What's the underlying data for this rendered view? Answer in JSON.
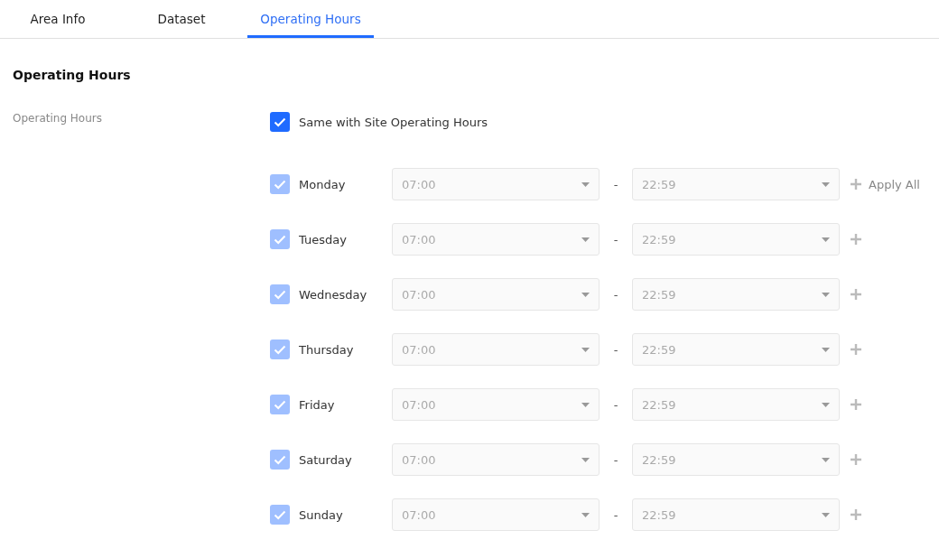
{
  "tabs": [
    {
      "label": "Area Info",
      "selected": false
    },
    {
      "label": "Dataset",
      "selected": false
    },
    {
      "label": "Operating Hours",
      "selected": true
    }
  ],
  "section_title": "Operating Hours",
  "field_label": "Operating Hours",
  "same_as_site": {
    "label": "Same with Site Operating Hours",
    "checked": true
  },
  "days": [
    {
      "name": "Monday",
      "checked": true,
      "disabled": true,
      "start": "07:00",
      "end": "22:59",
      "separator": "-",
      "apply_all": "Apply All"
    },
    {
      "name": "Tuesday",
      "checked": true,
      "disabled": true,
      "start": "07:00",
      "end": "22:59",
      "separator": "-"
    },
    {
      "name": "Wednesday",
      "checked": true,
      "disabled": true,
      "start": "07:00",
      "end": "22:59",
      "separator": "-"
    },
    {
      "name": "Thursday",
      "checked": true,
      "disabled": true,
      "start": "07:00",
      "end": "22:59",
      "separator": "-"
    },
    {
      "name": "Friday",
      "checked": true,
      "disabled": true,
      "start": "07:00",
      "end": "22:59",
      "separator": "-"
    },
    {
      "name": "Saturday",
      "checked": true,
      "disabled": true,
      "start": "07:00",
      "end": "22:59",
      "separator": "-"
    },
    {
      "name": "Sunday",
      "checked": true,
      "disabled": true,
      "start": "07:00",
      "end": "22:59",
      "separator": "-"
    }
  ]
}
